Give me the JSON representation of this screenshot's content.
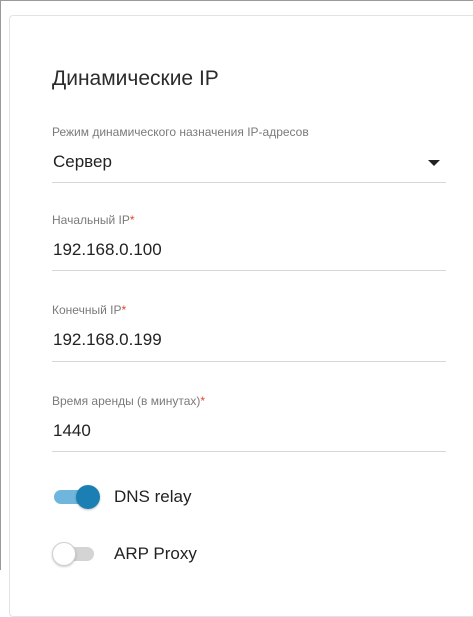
{
  "section": {
    "title": "Динамические IP"
  },
  "mode": {
    "label": "Режим динамического назначения IP-адресов",
    "value": "Сервер"
  },
  "start_ip": {
    "label": "Начальный IP",
    "required_mark": "*",
    "value": "192.168.0.100"
  },
  "end_ip": {
    "label": "Конечный IP",
    "required_mark": "*",
    "value": "192.168.0.199"
  },
  "lease_time": {
    "label": "Время аренды (в минутах)",
    "required_mark": "*",
    "value": "1440"
  },
  "toggles": {
    "dns_relay": {
      "label": "DNS relay",
      "on": true
    },
    "arp_proxy": {
      "label": "ARP Proxy",
      "on": false
    }
  },
  "colors": {
    "toggle_on_knob": "#1b7fb4",
    "toggle_on_track": "#6fb6dc",
    "toggle_off_track": "#d4d4d4",
    "toggle_off_knob": "#ffffff",
    "required": "#e0462b"
  }
}
